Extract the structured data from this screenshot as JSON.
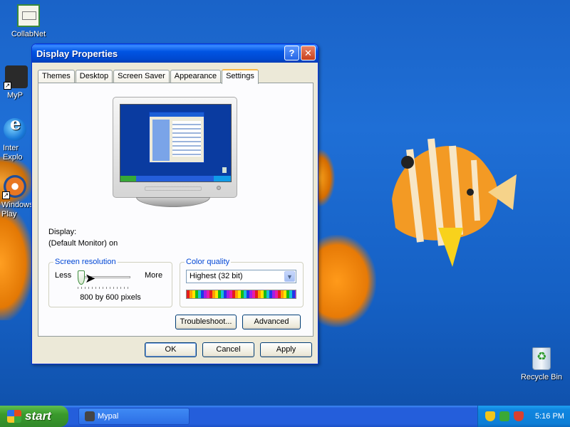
{
  "desktop": {
    "icons": [
      {
        "label": "CollabNet",
        "icon": "document-icon"
      },
      {
        "label": "MyP",
        "icon": "app-icon"
      },
      {
        "label": "Inter\nExplo",
        "icon": "internet-explorer-icon"
      },
      {
        "label": "Windows\nPlay",
        "icon": "media-player-icon"
      }
    ],
    "recycle_bin_label": "Recycle Bin"
  },
  "window": {
    "title": "Display Properties",
    "help_glyph": "?",
    "close_glyph": "✕",
    "tabs": [
      {
        "label": "Themes",
        "active": false
      },
      {
        "label": "Desktop",
        "active": false
      },
      {
        "label": "Screen Saver",
        "active": false
      },
      {
        "label": "Appearance",
        "active": false
      },
      {
        "label": "Settings",
        "active": true
      }
    ],
    "display_label": "Display:",
    "display_value": "(Default Monitor) on",
    "resolution": {
      "title": "Screen resolution",
      "less_label": "Less",
      "more_label": "More",
      "value_label": "800 by 600 pixels",
      "slider_position": 0
    },
    "color_quality": {
      "title": "Color quality",
      "selected": "Highest (32 bit)"
    },
    "buttons": {
      "troubleshoot": "Troubleshoot...",
      "advanced": "Advanced",
      "ok": "OK",
      "cancel": "Cancel",
      "apply": "Apply"
    }
  },
  "taskbar": {
    "start_label": "start",
    "task_item_label": "Mypal",
    "clock": "5:16 PM"
  },
  "colors": {
    "title_bar": "#0054e3",
    "desktop": "#1f6fd6",
    "taskbar": "#245edb",
    "start_button": "#3a9a2c"
  }
}
